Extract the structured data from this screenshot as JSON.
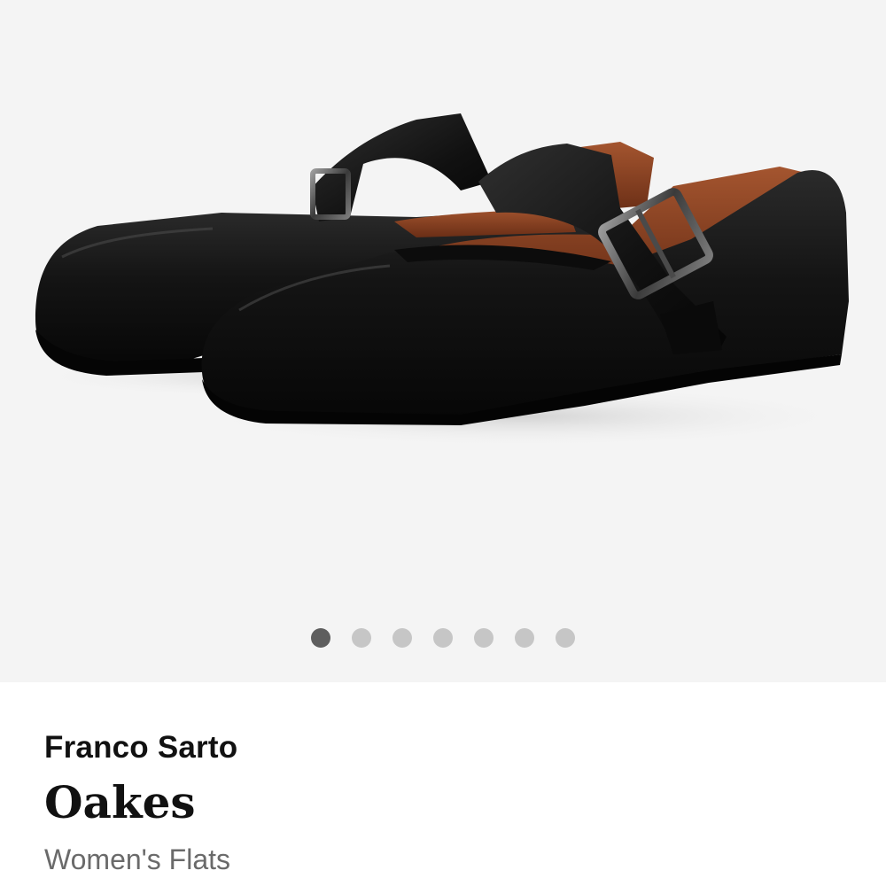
{
  "gallery": {
    "image_alt": "Franco Sarto Oakes black leather Mary Jane flats with buckle strap",
    "image_count": 7,
    "active_index": 0,
    "colors": {
      "background": "#f4f4f4",
      "dot_active": "#5e5e5e",
      "dot_inactive": "#c6c6c6"
    }
  },
  "product": {
    "brand": "Franco Sarto",
    "name": "Oakes",
    "category": "Women's Flats"
  }
}
